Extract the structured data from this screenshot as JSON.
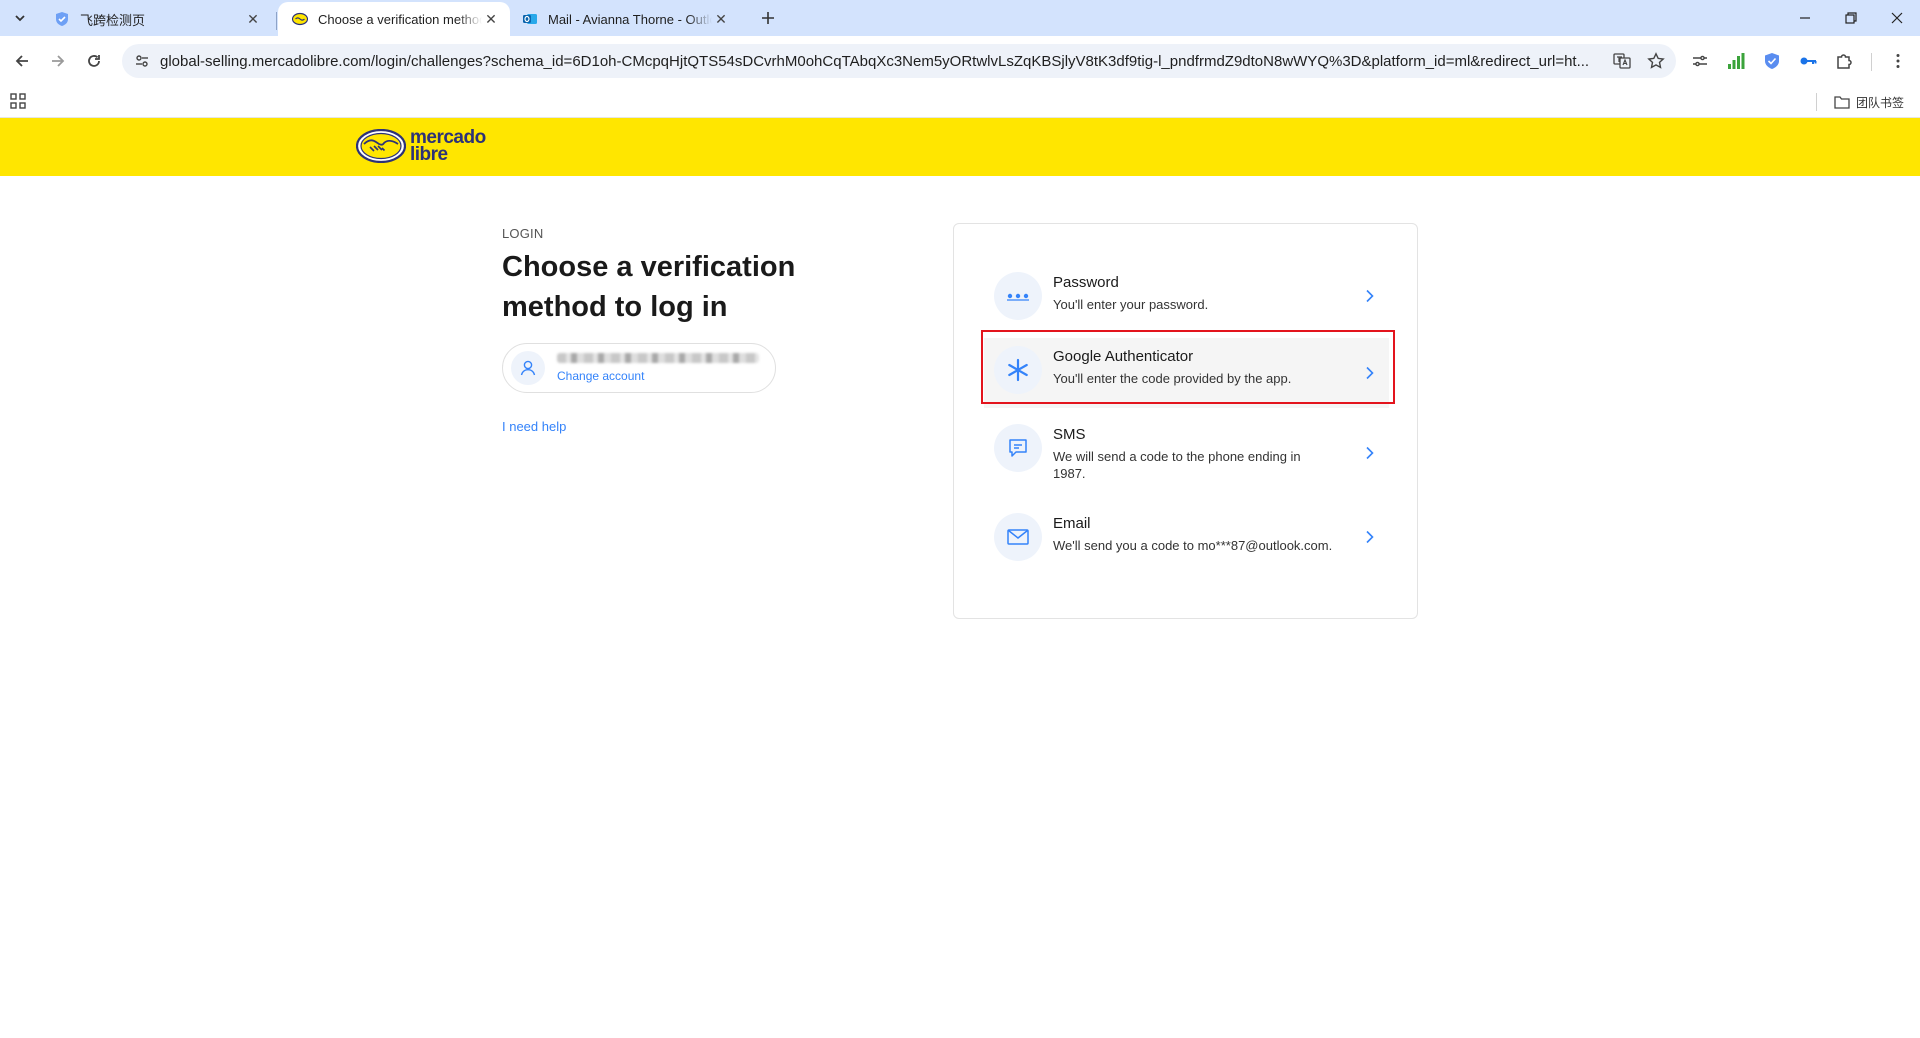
{
  "browser": {
    "tabs": [
      {
        "title": "飞跨检测页",
        "icon": "shield-icon"
      },
      {
        "title": "Choose a verification method",
        "icon": "mercadolibre-handshake-icon",
        "active": true
      },
      {
        "title": "Mail - Avianna Thorne - Outlook",
        "icon": "outlook-icon"
      }
    ],
    "url": "global-selling.mercadolibre.com/login/challenges?schema_id=6D1oh-CMcpqHjtQTS54sDCvrhM0ohCqTAbqXc3Nem5yORtwlvLsZqKBSjlyV8tK3df9tig-l_pndfrmdZ9dtoN8wWYQ%3D&platform_id=ml&redirect_url=ht...",
    "bookmark_folder": "团队书签"
  },
  "header": {
    "logo_line1": "mercado",
    "logo_line2": "libre",
    "brand_yellow": "#ffe600",
    "brand_navy": "#2d3277"
  },
  "login": {
    "eyebrow": "LOGIN",
    "heading": "Choose a verification method to log in",
    "change_account": "Change account",
    "help": "I need help"
  },
  "methods": [
    {
      "title": "Password",
      "description": "You'll enter your password.",
      "icon": "password-dots-icon"
    },
    {
      "title": "Google Authenticator",
      "description": "You'll enter the code provided by the app.",
      "icon": "asterisk-icon",
      "highlighted": true
    },
    {
      "title": "SMS",
      "description": "We will send a code to the phone ending in 1987.",
      "icon": "chat-icon"
    },
    {
      "title": "Email",
      "description": "We'll send you a code to mo***87@outlook.com.",
      "icon": "envelope-icon"
    }
  ],
  "colors": {
    "link": "#3483fa",
    "highlight_border": "#e3141d"
  }
}
